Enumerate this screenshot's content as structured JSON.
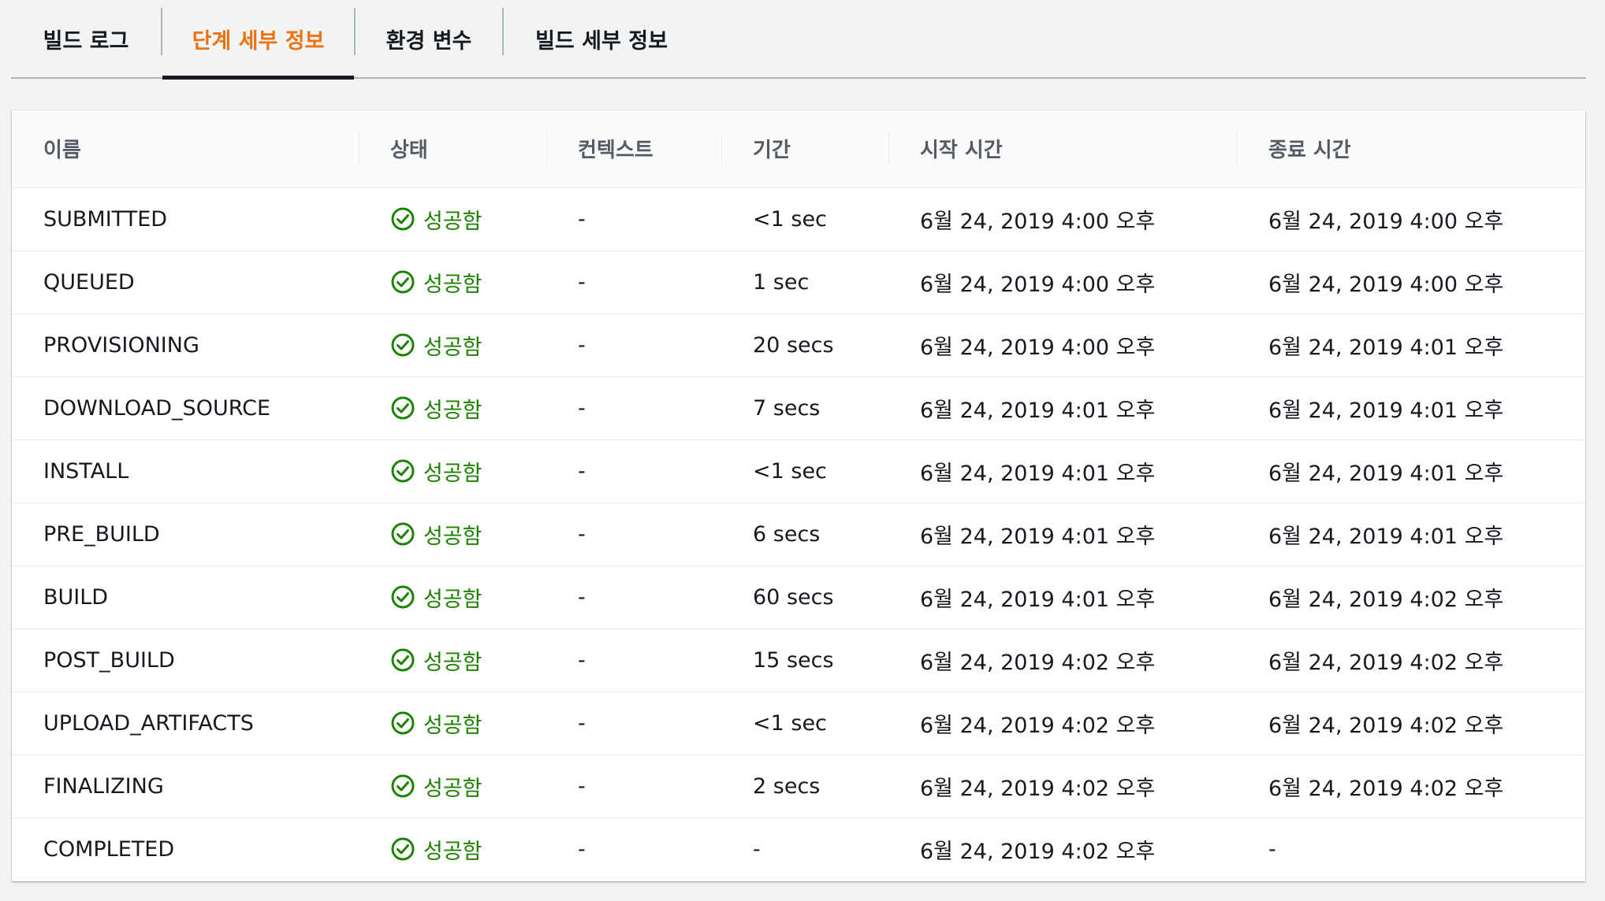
{
  "tabs": [
    {
      "label": "빌드 로그",
      "active": false
    },
    {
      "label": "단계 세부 정보",
      "active": true
    },
    {
      "label": "환경 변수",
      "active": false
    },
    {
      "label": "빌드 세부 정보",
      "active": false
    }
  ],
  "colors": {
    "accent": "#ec7211",
    "success": "#1d8102"
  },
  "status_icon": "check-circle-icon",
  "table": {
    "headers": [
      "이름",
      "상태",
      "컨텍스트",
      "기간",
      "시작 시간",
      "종료 시간"
    ],
    "rows": [
      {
        "name": "SUBMITTED",
        "status": "성공함",
        "context": "-",
        "duration": "<1 sec",
        "start": "6월 24, 2019 4:00 오후",
        "end": "6월 24, 2019 4:00 오후"
      },
      {
        "name": "QUEUED",
        "status": "성공함",
        "context": "-",
        "duration": "1 sec",
        "start": "6월 24, 2019 4:00 오후",
        "end": "6월 24, 2019 4:00 오후"
      },
      {
        "name": "PROVISIONING",
        "status": "성공함",
        "context": "-",
        "duration": "20 secs",
        "start": "6월 24, 2019 4:00 오후",
        "end": "6월 24, 2019 4:01 오후"
      },
      {
        "name": "DOWNLOAD_SOURCE",
        "status": "성공함",
        "context": "-",
        "duration": "7 secs",
        "start": "6월 24, 2019 4:01 오후",
        "end": "6월 24, 2019 4:01 오후"
      },
      {
        "name": "INSTALL",
        "status": "성공함",
        "context": "-",
        "duration": "<1 sec",
        "start": "6월 24, 2019 4:01 오후",
        "end": "6월 24, 2019 4:01 오후"
      },
      {
        "name": "PRE_BUILD",
        "status": "성공함",
        "context": "-",
        "duration": "6 secs",
        "start": "6월 24, 2019 4:01 오후",
        "end": "6월 24, 2019 4:01 오후"
      },
      {
        "name": "BUILD",
        "status": "성공함",
        "context": "-",
        "duration": "60 secs",
        "start": "6월 24, 2019 4:01 오후",
        "end": "6월 24, 2019 4:02 오후"
      },
      {
        "name": "POST_BUILD",
        "status": "성공함",
        "context": "-",
        "duration": "15 secs",
        "start": "6월 24, 2019 4:02 오후",
        "end": "6월 24, 2019 4:02 오후"
      },
      {
        "name": "UPLOAD_ARTIFACTS",
        "status": "성공함",
        "context": "-",
        "duration": "<1 sec",
        "start": "6월 24, 2019 4:02 오후",
        "end": "6월 24, 2019 4:02 오후"
      },
      {
        "name": "FINALIZING",
        "status": "성공함",
        "context": "-",
        "duration": "2 secs",
        "start": "6월 24, 2019 4:02 오후",
        "end": "6월 24, 2019 4:02 오후"
      },
      {
        "name": "COMPLETED",
        "status": "성공함",
        "context": "-",
        "duration": "-",
        "start": "6월 24, 2019 4:02 오후",
        "end": "-"
      }
    ]
  }
}
